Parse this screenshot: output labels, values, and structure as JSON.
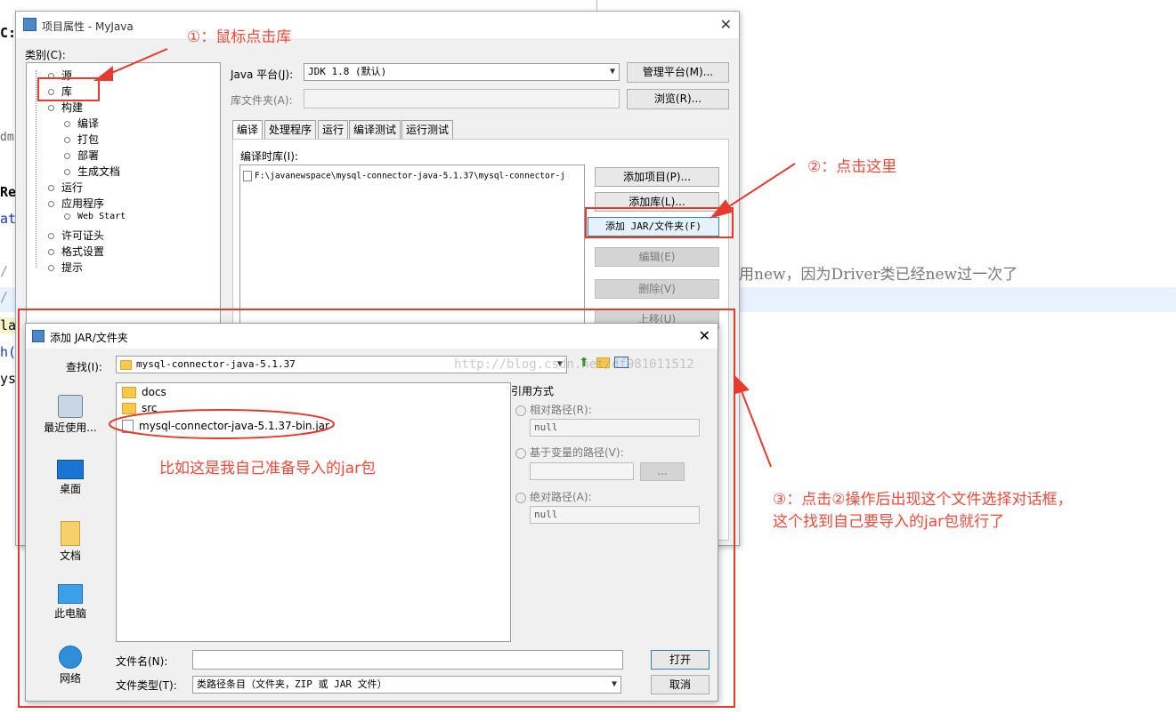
{
  "background_editor": {
    "fragments": [
      "C:",
      "dm",
      "Re",
      "at",
      "/",
      "/",
      "la",
      "h(",
      "ys"
    ],
    "comment_text": "用new，因为Driver类已经new过一次了"
  },
  "project_dialog": {
    "title": "项目属性 - MyJava",
    "categories_label": "类别(C):",
    "tree": [
      {
        "label": "源",
        "level": 0
      },
      {
        "label": "库",
        "level": 0
      },
      {
        "label": "构建",
        "level": 0
      },
      {
        "label": "编译",
        "level": 1
      },
      {
        "label": "打包",
        "level": 1
      },
      {
        "label": "部署",
        "level": 1
      },
      {
        "label": "生成文档",
        "level": 1
      },
      {
        "label": "运行",
        "level": 0
      },
      {
        "label": "应用程序",
        "level": 0
      },
      {
        "label": "Web Start",
        "level": 1
      },
      {
        "label": "许可证头",
        "level": 0
      },
      {
        "label": "格式设置",
        "level": 0
      },
      {
        "label": "提示",
        "level": 0
      }
    ],
    "java_platform_label": "Java 平台(J):",
    "java_platform_value": "JDK 1.8 (默认)",
    "manage_platform_button": "管理平台(M)...",
    "lib_folder_label": "库文件夹(A):",
    "browse_button": "浏览(R)...",
    "tabs": [
      "编译",
      "处理程序",
      "运行",
      "编译测试",
      "运行测试"
    ],
    "compile_libs_label": "编译时库(I):",
    "library_entry": "F:\\javanewspace\\mysql-connector-java-5.1.37\\mysql-connector-j",
    "buttons": {
      "add_project": "添加项目(P)...",
      "add_library": "添加库(L)...",
      "add_jar": "添加 JAR/文件夹(F)",
      "edit": "编辑(E)",
      "remove": "删除(V)",
      "move_up": "上移(U)"
    }
  },
  "file_dialog": {
    "title": "添加 JAR/文件夹",
    "lookin_label": "查找(I):",
    "lookin_value": "mysql-connector-java-5.1.37",
    "places": [
      "最近使用...",
      "桌面",
      "文档",
      "此电脑",
      "网络"
    ],
    "files": [
      {
        "name": "docs",
        "type": "folder"
      },
      {
        "name": "src",
        "type": "folder"
      },
      {
        "name": "mysql-connector-java-5.1.37-bin.jar",
        "type": "jar"
      }
    ],
    "reference_label": "引用方式",
    "relative_path_label": "相对路径(R):",
    "relative_path_value": "null",
    "variable_path_label": "基于变量的路径(V):",
    "variable_browse": "...",
    "absolute_path_label": "绝对路径(A):",
    "absolute_path_value": "null",
    "filename_label": "文件名(N):",
    "filename_value": "",
    "filetype_label": "文件类型(T):",
    "filetype_value": "类路径条目（文件夹，ZIP 或 JAR 文件）",
    "open_button": "打开",
    "cancel_button": "取消"
  },
  "annotations": {
    "step1": "①：鼠标点击库",
    "step2": "②：点击这里",
    "step3_line1": "③：点击②操作后出现这个文件选择对话框，",
    "step3_line2": "这个找到自己要导入的jar包就行了",
    "note": "比如这是我自己准备导入的jar包",
    "color": "#f04a3b"
  },
  "watermark": "http://blog.csdn.net/df981011512"
}
